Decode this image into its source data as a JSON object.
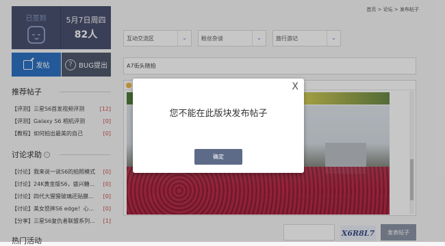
{
  "signin": {
    "status": "已签到",
    "date": "5月7日周四",
    "count": "82人"
  },
  "actions": {
    "post": "发帖",
    "bug": "BUG提出"
  },
  "recommended": {
    "title": "推荐帖子",
    "items": [
      {
        "text": "【评测】三星S6首发视频评测",
        "num": "[12]"
      },
      {
        "text": "【评测】Galaxy S6 相机评测",
        "num": "[0]"
      },
      {
        "text": "【教程】如何拍出最美的自己",
        "num": "[0]"
      }
    ]
  },
  "discussion": {
    "title": "讨论求助",
    "items": [
      {
        "text": "【讨论】我来说一说S6的拍照模式",
        "num": "[0]"
      },
      {
        "text": "【讨论】24K黄金版S6，盛兴糖...",
        "num": "[0]"
      },
      {
        "text": "【讨论】四代大猩猩玻璃还贴膜...",
        "num": "[0]"
      },
      {
        "text": "【讨论】美女怒摔S6 edge！心...",
        "num": "[0]"
      },
      {
        "text": "【分享】三星S6复仇者联盟系列...",
        "num": "[1]"
      }
    ]
  },
  "hot": {
    "title": "热门活动"
  },
  "breadcrumb": "首页 > 论坛 > 发布帖子",
  "selects": [
    "互动交流区",
    "粉丝杂谈",
    "旅行游记"
  ],
  "title_value": "A7街头随拍",
  "captcha": "X6R8L7",
  "submit": "发表帖子",
  "dialog": {
    "close": "X",
    "message": "您不能在此版块发布帖子",
    "ok": "确定"
  }
}
